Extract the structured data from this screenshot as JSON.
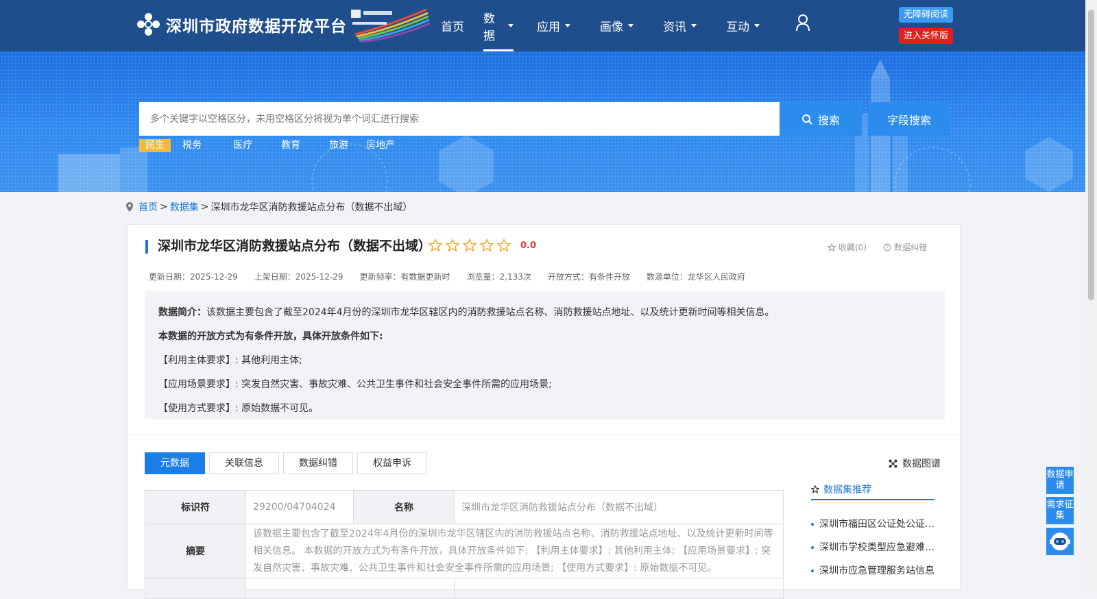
{
  "header": {
    "site_title": "深圳市政府数据开放平台",
    "nav": [
      {
        "label": "首页",
        "has_menu": false,
        "active": false
      },
      {
        "label": "数据",
        "has_menu": true,
        "active": true
      },
      {
        "label": "应用",
        "has_menu": true,
        "active": false
      },
      {
        "label": "画像",
        "has_menu": true,
        "active": false
      },
      {
        "label": "资讯",
        "has_menu": true,
        "active": false
      },
      {
        "label": "互动",
        "has_menu": true,
        "active": false
      }
    ],
    "accessibility_label": "无障碍阅读",
    "care_label": "进入关怀版"
  },
  "search": {
    "placeholder": "多个关键字以空格区分，未用空格区分将视为单个词汇进行搜索",
    "search_button": "搜索",
    "field_search_button": "字段搜索",
    "hot_tags": [
      "民生",
      "税务",
      "医疗",
      "教育",
      "旅游",
      "房地产"
    ]
  },
  "breadcrumb": {
    "home": "首页",
    "sep": ">",
    "datasets": "数据集",
    "current": "深圳市龙华区消防救援站点分布（数据不出域）"
  },
  "dataset": {
    "title": "深圳市龙华区消防救援站点分布（数据不出域）",
    "stars": 5,
    "rating": "0.0",
    "favorite": "收藏(0)",
    "correction": "数据纠错",
    "meta": {
      "update_date": "更新日期：2025-12-29",
      "publish_date": "上架日期：2025-12-29",
      "frequency": "更新频率：有数据更新时",
      "views": "浏览量：2,133次",
      "open_mode": "开放方式：有条件开放",
      "source": "数源单位：龙华区人民政府"
    },
    "intro": {
      "intro_label": "数据简介：",
      "intro_text": "该数据主要包含了截至2024年4月份的深圳市龙华区辖区内的消防救援站点名称、消防救援站点地址、以及统计更新时间等相关信息。",
      "open_title": "本数据的开放方式为有条件开放，具体开放条件如下:",
      "req_subject": "【利用主体要求】: 其他利用主体;",
      "req_scene": "【应用场景要求】: 突发自然灾害、事故灾难、公共卫生事件和社会安全事件所需的应用场景;",
      "req_usage": "【使用方式要求】: 原始数据不可见。"
    }
  },
  "tabs": [
    "元数据",
    "关联信息",
    "数据纠错",
    "权益申诉"
  ],
  "graph_link": "数据图谱",
  "metadata_table": {
    "id_label": "标识符",
    "id_value": "29200/04704024",
    "name_label": "名称",
    "name_value": "深圳市龙华区消防救援站点分布（数据不出域）",
    "abstract_label": "摘要",
    "abstract_value": "该数据主要包含了截至2024年4月份的深圳市龙华区辖区内的消防救援站点名称、消防救援站点地址、以及统计更新时间等相关信息。 本数据的开放方式为有条件开放，具体开放条件如下: 【利用主体要求】: 其他利用主体; 【应用场景要求】: 突发自然灾害、事故灾难、公共卫生事件和社会安全事件所需的应用场景; 【使用方式要求】: 原始数据不可见。"
  },
  "recommend": {
    "title": "数据集推荐",
    "items": [
      "深圳市福田区公证处公证员信息",
      "深圳市学校类型应急避难场所",
      "深圳市应急管理服务站信息"
    ]
  },
  "float": {
    "apply": "数据申请",
    "demand": "需求征集"
  },
  "colors": {
    "header_bg": "#1e4e8c",
    "accent": "#1b76d4",
    "button": "#2b8cee",
    "care_red": "#e0201c",
    "tag_orange": "#f5b93a"
  }
}
